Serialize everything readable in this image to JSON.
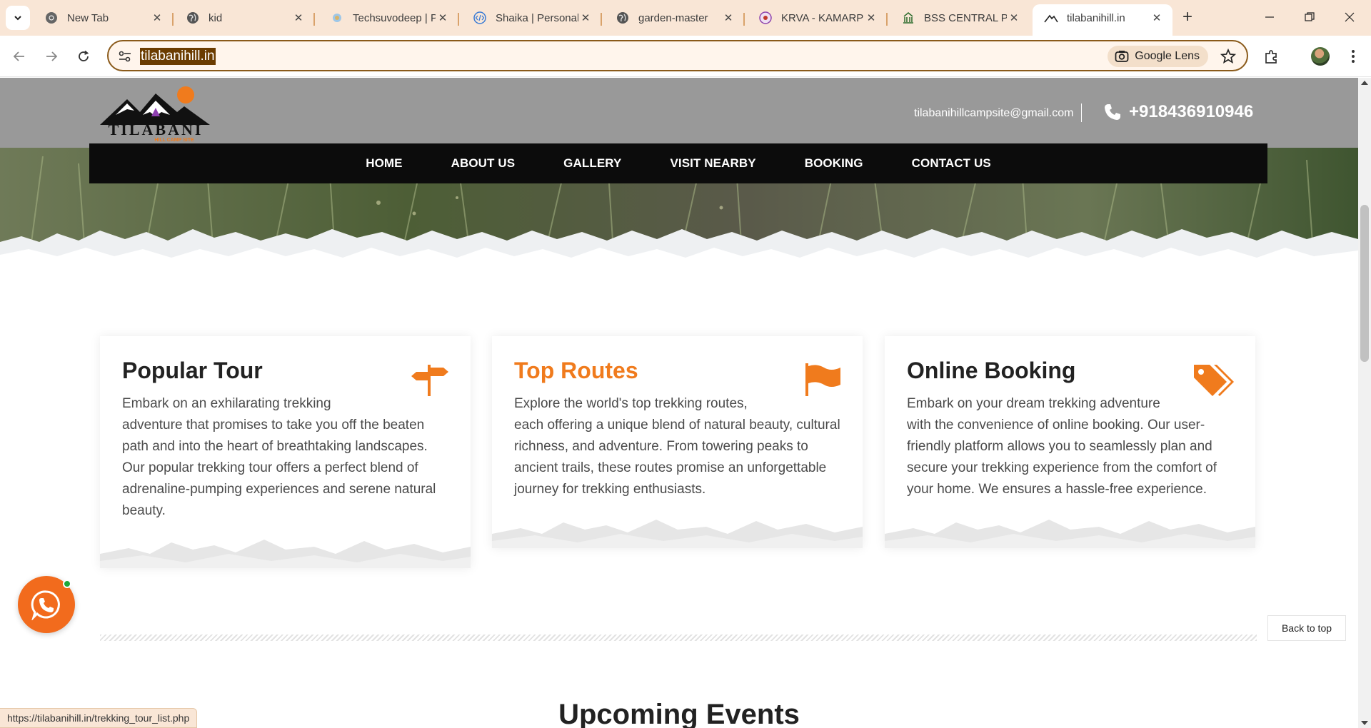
{
  "browser": {
    "tabs": [
      {
        "label": "New Tab",
        "icon": "chrome-icon"
      },
      {
        "label": "kid",
        "icon": "globe-icon"
      },
      {
        "label": "Techsuvodeep | P",
        "icon": "site-icon"
      },
      {
        "label": "Shaika | Personal",
        "icon": "code-icon"
      },
      {
        "label": "garden-master",
        "icon": "globe-icon"
      },
      {
        "label": "KRVA - KAMARP",
        "icon": "emblem-icon"
      },
      {
        "label": "BSS CENTRAL PU",
        "icon": "building-icon"
      },
      {
        "label": "tilabanihill.in",
        "icon": "mountain-icon",
        "active": true
      }
    ],
    "url": "tilabanihill.in",
    "lens_label": "Google Lens",
    "status_url": "https://tilabanihill.in/trekking_tour_list.php"
  },
  "site": {
    "logo_text": "TILABANI",
    "logo_subtext": "HILL CAMP SITE",
    "email": "tilabanihillcampsite@gmail.com",
    "phone": "+918436910946",
    "nav": [
      "HOME",
      "ABOUT US",
      "GALLERY",
      "VISIT NEARBY",
      "BOOKING",
      "CONTACT US"
    ]
  },
  "cards": [
    {
      "title": "Popular Tour",
      "icon": "signpost-icon",
      "lines": [
        "Embark on an exhilarating trekking",
        "adventure that promises to take you off the beaten",
        "path and into the heart of breathtaking landscapes.",
        "Our popular trekking tour offers a perfect blend of",
        "adrenaline-pumping experiences and serene natural",
        "beauty."
      ]
    },
    {
      "title": "Top Routes",
      "icon": "flag-icon",
      "lines": [
        "Explore the world's top trekking routes,",
        "each offering a unique blend of natural beauty, cultural",
        "richness, and adventure. From towering peaks to",
        "ancient trails, these routes promise an unforgettable",
        "journey for trekking enthusiasts."
      ]
    },
    {
      "title": "Online Booking",
      "icon": "tags-icon",
      "lines": [
        "Embark on your dream trekking adventure",
        "with the convenience of online booking. Our user-",
        "friendly platform allows you to seamlessly plan and",
        "secure your trekking experience from the comfort of",
        "your home. We ensures a hassle-free experience."
      ]
    }
  ],
  "events_title": "Upcoming Events",
  "back_to_top": "Back to top",
  "colors": {
    "accent": "#f07b1d",
    "nav_bg": "#0c0c0c",
    "header_bg": "#999999",
    "whatsapp_bg": "#f26b1d"
  }
}
